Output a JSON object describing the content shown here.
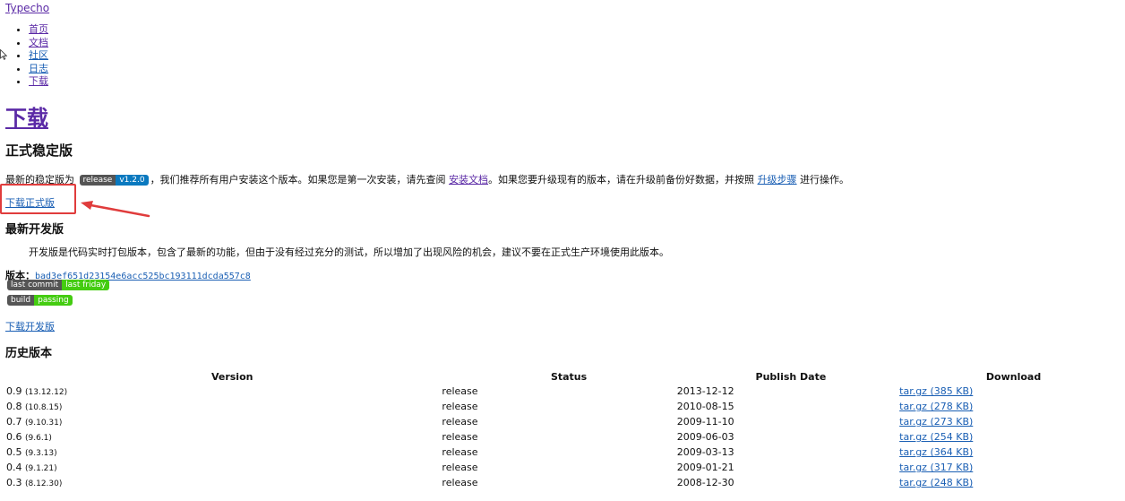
{
  "site": {
    "brand": "Typecho"
  },
  "nav": [
    {
      "label": "首页"
    },
    {
      "label": "文档"
    },
    {
      "label": "社区"
    },
    {
      "label": "日志"
    },
    {
      "label": "下载"
    }
  ],
  "page_title": "下载",
  "stable": {
    "heading": "正式稳定版",
    "text_before_badge": "最新的稳定版为 ",
    "badge_left": "release",
    "badge_right": "v1.2.0",
    "text_mid": "，我们推荐所有用户安装这个版本。如果您是第一次安装，请先查阅 ",
    "install_doc_link": "安装文档",
    "text_mid2": "。如果您要升级现有的版本，请在升级前备份好数据，并按照 ",
    "upgrade_link": "升级步骤",
    "text_after": " 进行操作。",
    "download_link": "下载正式版"
  },
  "dev": {
    "heading": "最新开发版",
    "description": "开发版是代码实时打包版本，包含了最新的功能，但由于没有经过充分的测试，所以增加了出现风险的机会，建议不要在正式生产环境使用此版本。",
    "version_label": "版本：",
    "version_hash": "bad3ef651d23154e6acc525bc193111dcda557c8",
    "commit_badge_left": "last commit",
    "commit_badge_right": "last friday",
    "build_badge_left": "build",
    "build_badge_right": "passing",
    "download_link": "下载开发版"
  },
  "history": {
    "heading": "历史版本",
    "columns": [
      "Version",
      "Status",
      "Publish Date",
      "Download"
    ],
    "rows": [
      {
        "version": "0.9",
        "sub": "(13.12.12)",
        "status": "release",
        "date": "2013-12-12",
        "download": "tar.gz (385 KB)"
      },
      {
        "version": "0.8",
        "sub": "(10.8.15)",
        "status": "release",
        "date": "2010-08-15",
        "download": "tar.gz (278 KB)"
      },
      {
        "version": "0.7",
        "sub": "(9.10.31)",
        "status": "release",
        "date": "2009-11-10",
        "download": "tar.gz (273 KB)"
      },
      {
        "version": "0.6",
        "sub": "(9.6.1)",
        "status": "release",
        "date": "2009-06-03",
        "download": "tar.gz (254 KB)"
      },
      {
        "version": "0.5",
        "sub": "(9.3.13)",
        "status": "release",
        "date": "2009-03-13",
        "download": "tar.gz (364 KB)"
      },
      {
        "version": "0.4",
        "sub": "(9.1.21)",
        "status": "release",
        "date": "2009-01-21",
        "download": "tar.gz (317 KB)"
      },
      {
        "version": "0.3",
        "sub": "(8.12.30)",
        "status": "release",
        "date": "2008-12-30",
        "download": "tar.gz (248 KB)"
      }
    ]
  },
  "colors": {
    "link": "#1a5fb4",
    "visited": "#5b2aa6",
    "annotation": "#e03c3c"
  }
}
